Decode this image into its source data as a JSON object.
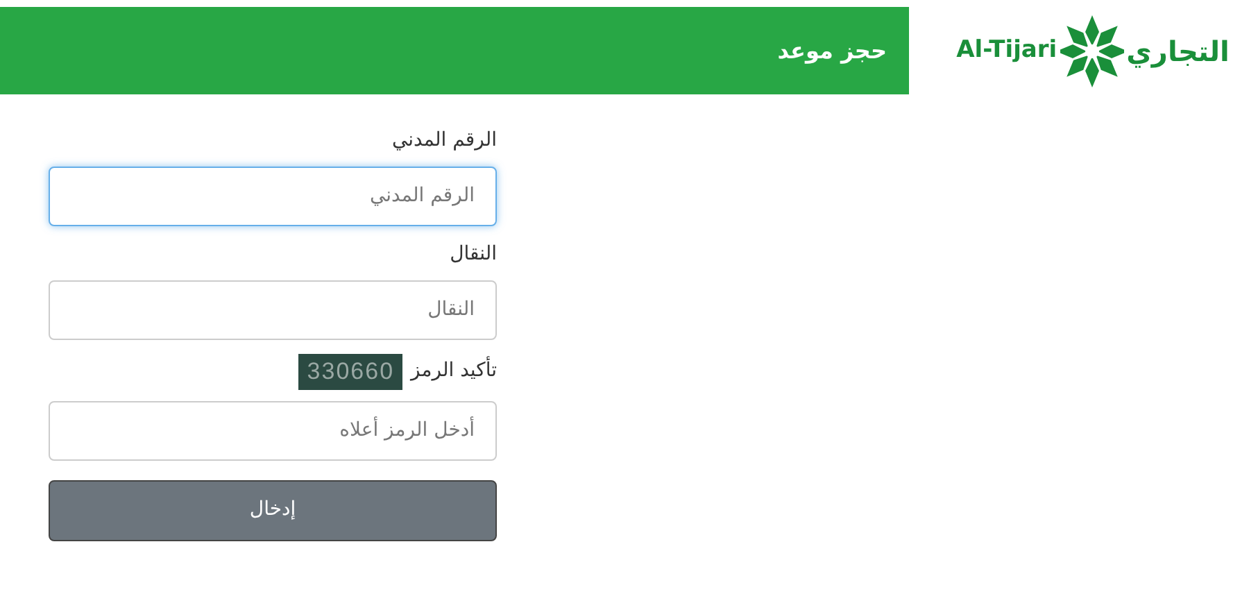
{
  "header": {
    "title": "حجز موعد"
  },
  "logo": {
    "latin": "Al-Tijari",
    "arabic": "التجاري"
  },
  "form": {
    "fields": [
      {
        "label": "الرقم المدني",
        "placeholder": "الرقم المدني",
        "focused": true,
        "kind": "text"
      },
      {
        "label": "النقال",
        "placeholder": "النقال",
        "focused": false,
        "kind": "text"
      },
      {
        "label": "تأكيد الرمز",
        "captcha": "330660",
        "placeholder": "أدخل الرمز أعلاه",
        "focused": false,
        "kind": "captcha"
      }
    ],
    "submit": "إدخال"
  }
}
